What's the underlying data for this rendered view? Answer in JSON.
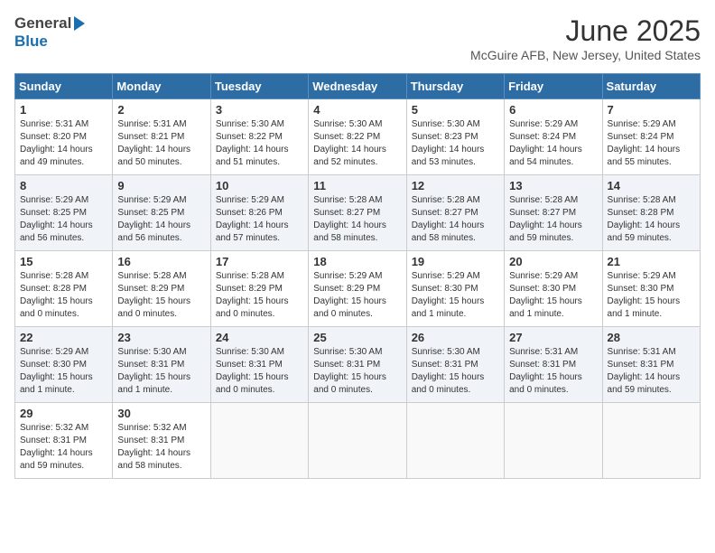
{
  "header": {
    "logo_general": "General",
    "logo_blue": "Blue",
    "month": "June 2025",
    "location": "McGuire AFB, New Jersey, United States"
  },
  "days_of_week": [
    "Sunday",
    "Monday",
    "Tuesday",
    "Wednesday",
    "Thursday",
    "Friday",
    "Saturday"
  ],
  "weeks": [
    [
      {
        "day": "1",
        "sunrise": "5:31 AM",
        "sunset": "8:20 PM",
        "daylight": "14 hours and 49 minutes."
      },
      {
        "day": "2",
        "sunrise": "5:31 AM",
        "sunset": "8:21 PM",
        "daylight": "14 hours and 50 minutes."
      },
      {
        "day": "3",
        "sunrise": "5:30 AM",
        "sunset": "8:22 PM",
        "daylight": "14 hours and 51 minutes."
      },
      {
        "day": "4",
        "sunrise": "5:30 AM",
        "sunset": "8:22 PM",
        "daylight": "14 hours and 52 minutes."
      },
      {
        "day": "5",
        "sunrise": "5:30 AM",
        "sunset": "8:23 PM",
        "daylight": "14 hours and 53 minutes."
      },
      {
        "day": "6",
        "sunrise": "5:29 AM",
        "sunset": "8:24 PM",
        "daylight": "14 hours and 54 minutes."
      },
      {
        "day": "7",
        "sunrise": "5:29 AM",
        "sunset": "8:24 PM",
        "daylight": "14 hours and 55 minutes."
      }
    ],
    [
      {
        "day": "8",
        "sunrise": "5:29 AM",
        "sunset": "8:25 PM",
        "daylight": "14 hours and 56 minutes."
      },
      {
        "day": "9",
        "sunrise": "5:29 AM",
        "sunset": "8:25 PM",
        "daylight": "14 hours and 56 minutes."
      },
      {
        "day": "10",
        "sunrise": "5:29 AM",
        "sunset": "8:26 PM",
        "daylight": "14 hours and 57 minutes."
      },
      {
        "day": "11",
        "sunrise": "5:28 AM",
        "sunset": "8:27 PM",
        "daylight": "14 hours and 58 minutes."
      },
      {
        "day": "12",
        "sunrise": "5:28 AM",
        "sunset": "8:27 PM",
        "daylight": "14 hours and 58 minutes."
      },
      {
        "day": "13",
        "sunrise": "5:28 AM",
        "sunset": "8:27 PM",
        "daylight": "14 hours and 59 minutes."
      },
      {
        "day": "14",
        "sunrise": "5:28 AM",
        "sunset": "8:28 PM",
        "daylight": "14 hours and 59 minutes."
      }
    ],
    [
      {
        "day": "15",
        "sunrise": "5:28 AM",
        "sunset": "8:28 PM",
        "daylight": "15 hours and 0 minutes."
      },
      {
        "day": "16",
        "sunrise": "5:28 AM",
        "sunset": "8:29 PM",
        "daylight": "15 hours and 0 minutes."
      },
      {
        "day": "17",
        "sunrise": "5:28 AM",
        "sunset": "8:29 PM",
        "daylight": "15 hours and 0 minutes."
      },
      {
        "day": "18",
        "sunrise": "5:29 AM",
        "sunset": "8:29 PM",
        "daylight": "15 hours and 0 minutes."
      },
      {
        "day": "19",
        "sunrise": "5:29 AM",
        "sunset": "8:30 PM",
        "daylight": "15 hours and 1 minute."
      },
      {
        "day": "20",
        "sunrise": "5:29 AM",
        "sunset": "8:30 PM",
        "daylight": "15 hours and 1 minute."
      },
      {
        "day": "21",
        "sunrise": "5:29 AM",
        "sunset": "8:30 PM",
        "daylight": "15 hours and 1 minute."
      }
    ],
    [
      {
        "day": "22",
        "sunrise": "5:29 AM",
        "sunset": "8:30 PM",
        "daylight": "15 hours and 1 minute."
      },
      {
        "day": "23",
        "sunrise": "5:30 AM",
        "sunset": "8:31 PM",
        "daylight": "15 hours and 1 minute."
      },
      {
        "day": "24",
        "sunrise": "5:30 AM",
        "sunset": "8:31 PM",
        "daylight": "15 hours and 0 minutes."
      },
      {
        "day": "25",
        "sunrise": "5:30 AM",
        "sunset": "8:31 PM",
        "daylight": "15 hours and 0 minutes."
      },
      {
        "day": "26",
        "sunrise": "5:30 AM",
        "sunset": "8:31 PM",
        "daylight": "15 hours and 0 minutes."
      },
      {
        "day": "27",
        "sunrise": "5:31 AM",
        "sunset": "8:31 PM",
        "daylight": "15 hours and 0 minutes."
      },
      {
        "day": "28",
        "sunrise": "5:31 AM",
        "sunset": "8:31 PM",
        "daylight": "14 hours and 59 minutes."
      }
    ],
    [
      {
        "day": "29",
        "sunrise": "5:32 AM",
        "sunset": "8:31 PM",
        "daylight": "14 hours and 59 minutes."
      },
      {
        "day": "30",
        "sunrise": "5:32 AM",
        "sunset": "8:31 PM",
        "daylight": "14 hours and 58 minutes."
      },
      null,
      null,
      null,
      null,
      null
    ]
  ],
  "labels": {
    "sunrise": "Sunrise:",
    "sunset": "Sunset:",
    "daylight": "Daylight:"
  }
}
